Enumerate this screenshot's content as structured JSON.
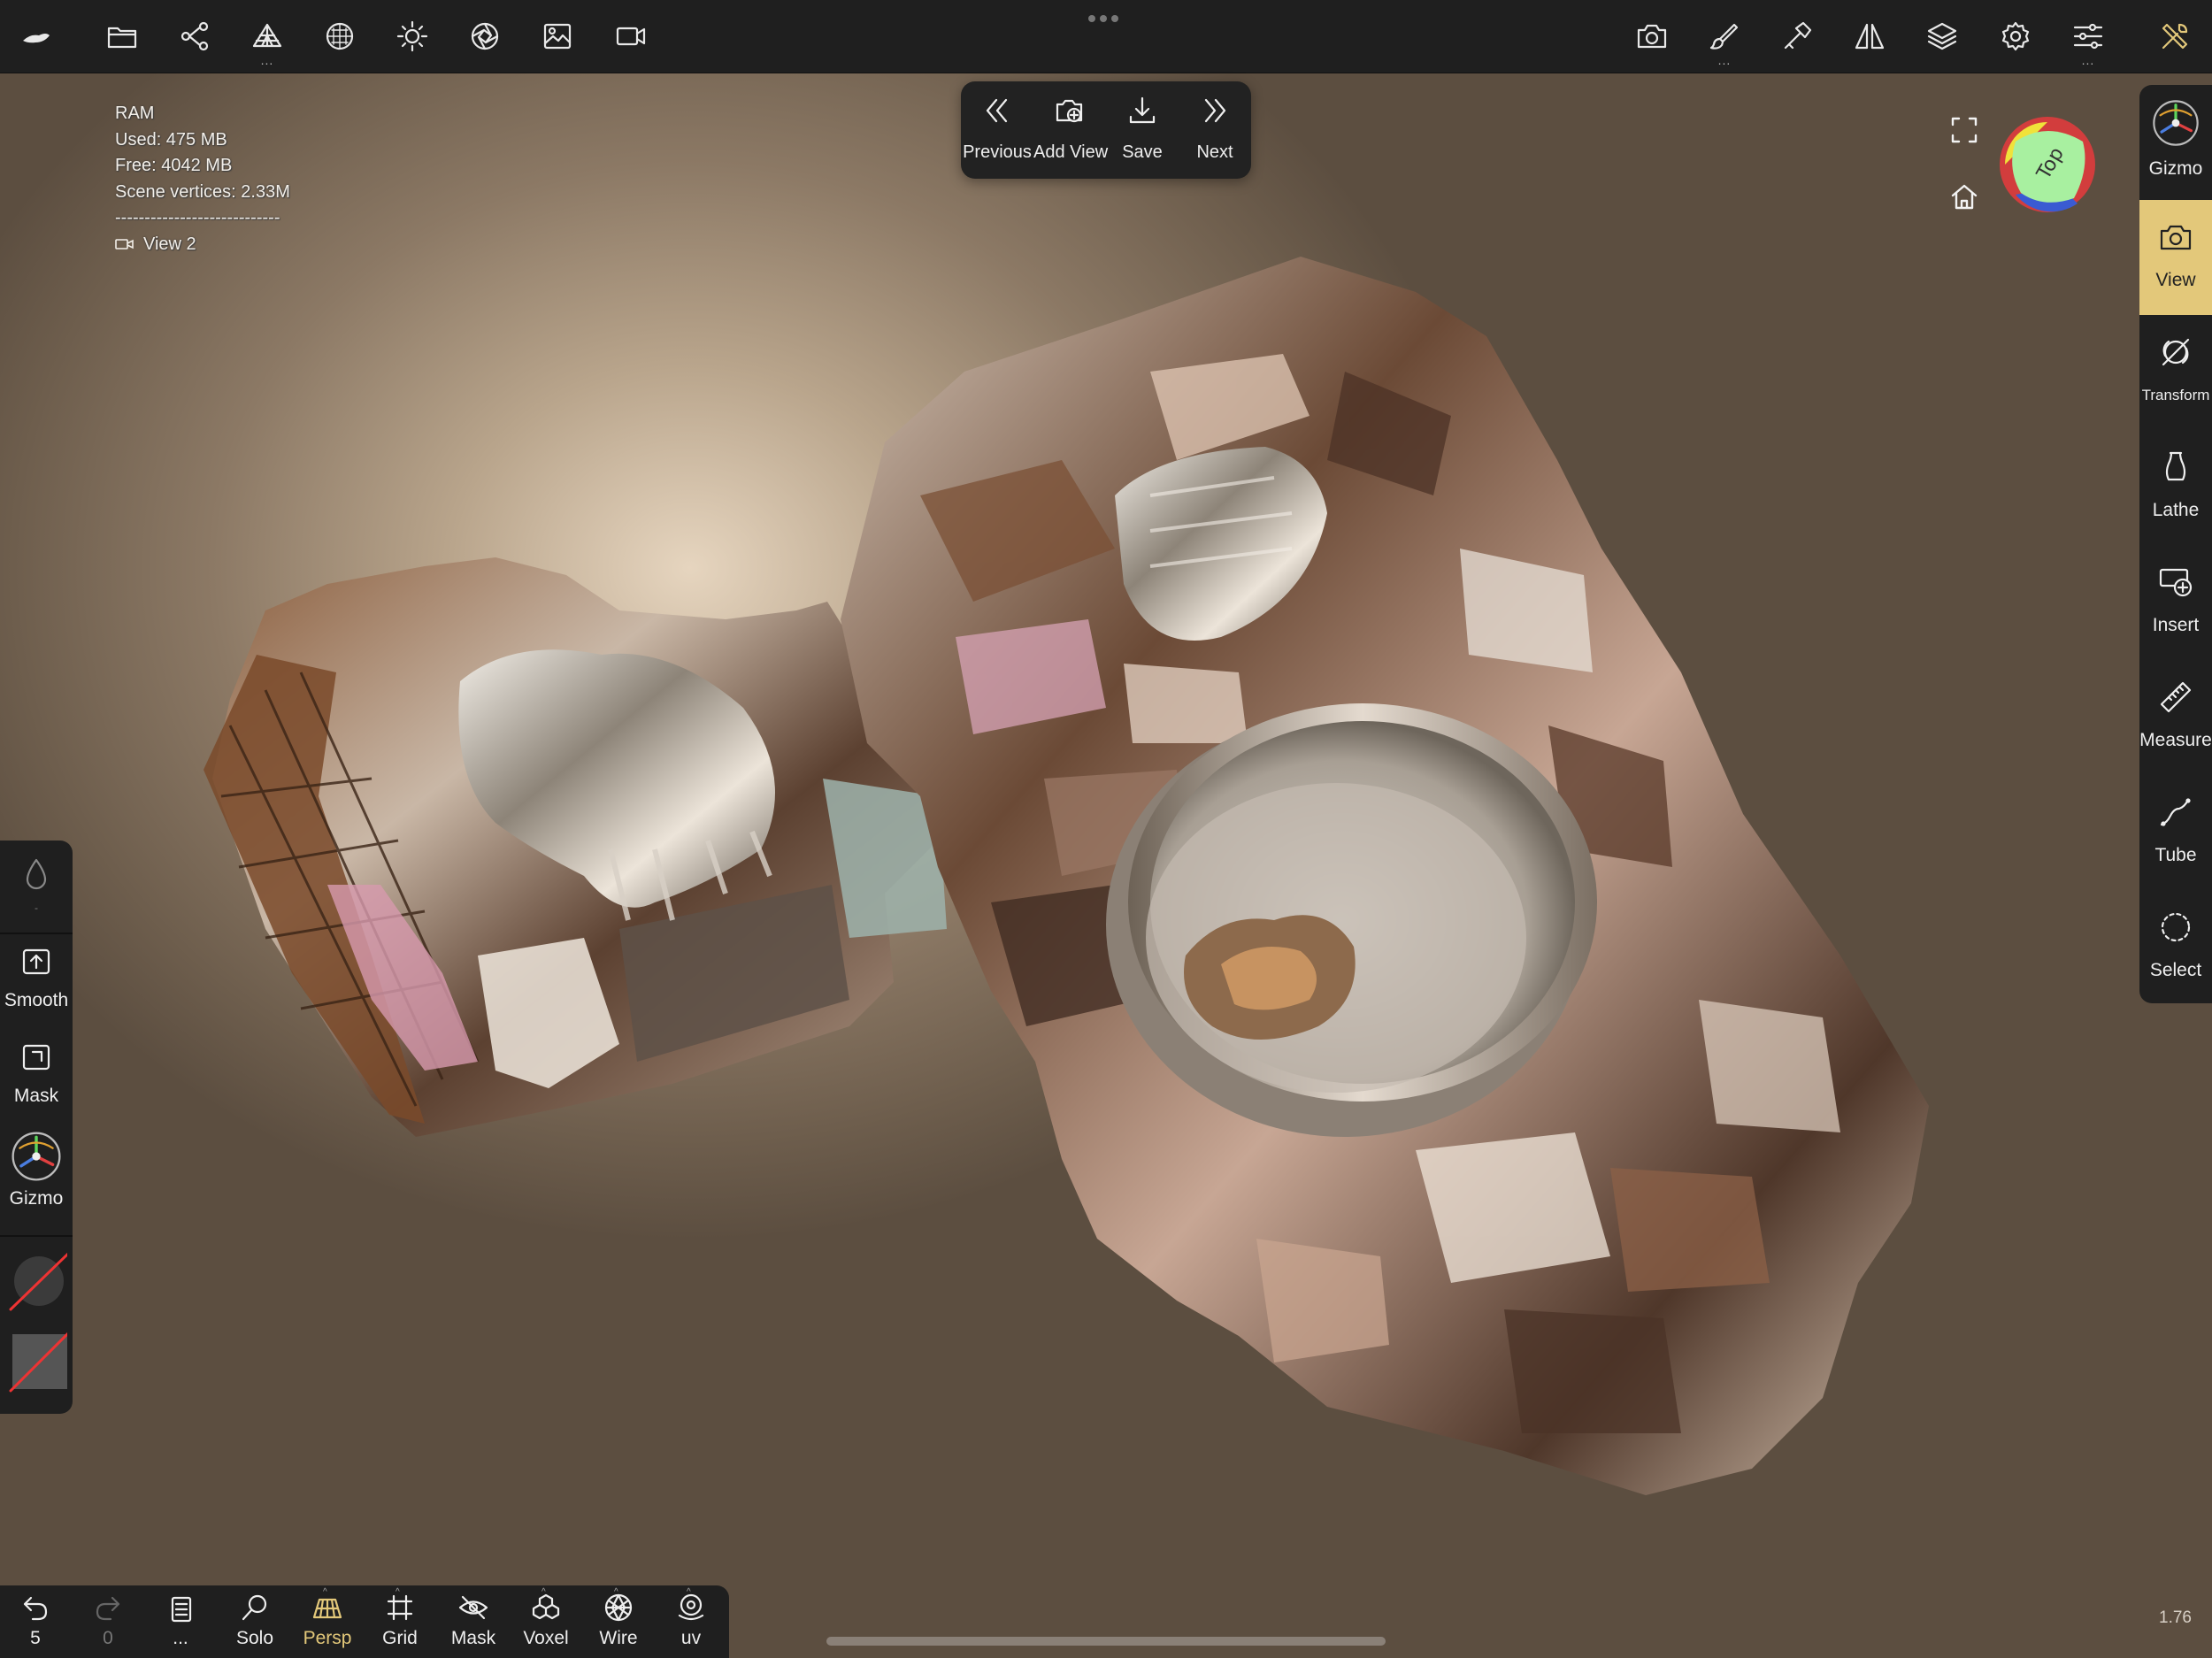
{
  "topbar": {
    "left_icons": [
      "app-logo-icon",
      "folder-icon",
      "scene-graph-icon",
      "topology-icon",
      "material-sphere-icon",
      "light-icon",
      "shading-aperture-icon",
      "background-image-icon",
      "video-camera-icon"
    ],
    "right_icons": [
      "camera-icon",
      "paint-brush-icon",
      "hammer-icon",
      "symmetry-icon",
      "layers-icon",
      "settings-gear-icon",
      "sliders-icon",
      "tools-icon"
    ],
    "dots": "..."
  },
  "info": {
    "ram_label": "RAM",
    "used": "Used: 475 MB",
    "free": "Free: 4042 MB",
    "scene_vertices": "Scene vertices: 2.33M",
    "separator": "----------------------------",
    "view_name": "View 2"
  },
  "views_popup": {
    "previous": "Previous",
    "add_view": "Add View",
    "save": "Save",
    "next": "Next"
  },
  "orientation_cube": {
    "face_label": "Top",
    "face_color": "#a8f0a0"
  },
  "right_bar": {
    "items": [
      {
        "label": "Gizmo",
        "icon": "gizmo-icon"
      },
      {
        "label": "View",
        "icon": "camera-icon"
      },
      {
        "label": "Transform",
        "icon": "transform-icon"
      },
      {
        "label": "Lathe",
        "icon": "lathe-vase-icon"
      },
      {
        "label": "Insert",
        "icon": "insert-icon"
      },
      {
        "label": "Measure",
        "icon": "ruler-icon"
      },
      {
        "label": "Tube",
        "icon": "tube-curve-icon"
      },
      {
        "label": "Select",
        "icon": "select-lasso-icon"
      }
    ],
    "active": "View",
    "accent_color": "#e3c87a"
  },
  "left_panel": {
    "items": [
      {
        "label": "Smooth"
      },
      {
        "label": "Mask"
      },
      {
        "label": "Gizmo"
      }
    ]
  },
  "bottom_bar": {
    "undo_count": "5",
    "redo_count": "0",
    "more": "...",
    "items": [
      {
        "label": "Solo"
      },
      {
        "label": "Persp"
      },
      {
        "label": "Grid"
      },
      {
        "label": "Mask"
      },
      {
        "label": "Voxel"
      },
      {
        "label": "Wire"
      },
      {
        "label": "uv"
      }
    ],
    "active": "Persp"
  },
  "zoom": "1.76"
}
